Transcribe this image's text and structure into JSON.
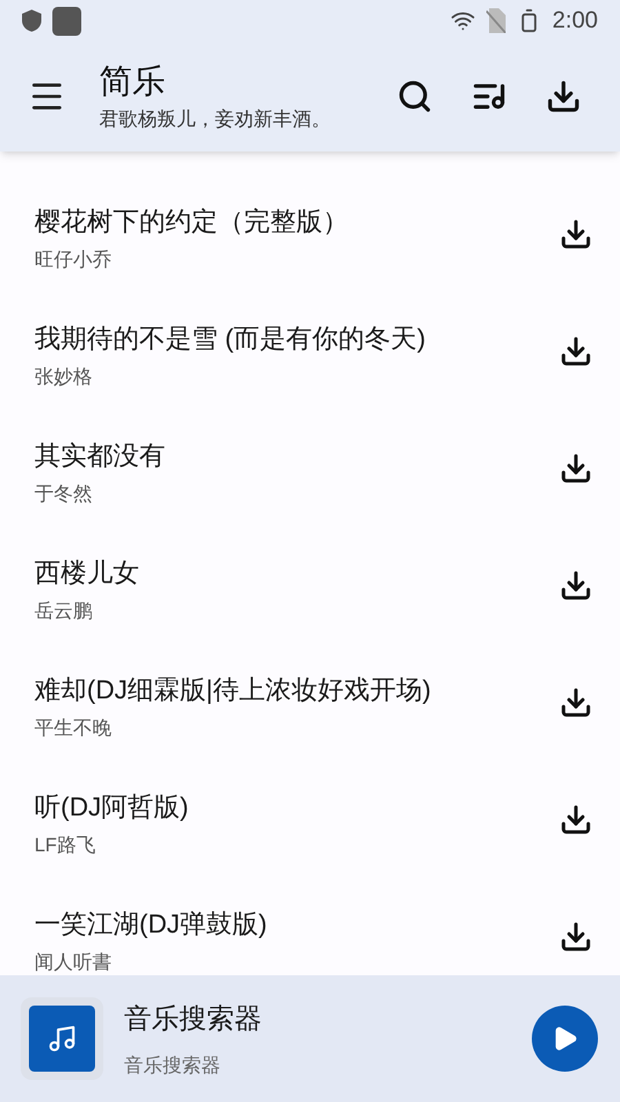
{
  "status_bar": {
    "time": "2:00"
  },
  "app_bar": {
    "title": "简乐",
    "subtitle": "君歌杨叛儿，妾劝新丰酒。"
  },
  "songs": [
    {
      "title": "樱花树下的约定（完整版）",
      "artist": "旺仔小乔"
    },
    {
      "title": "我期待的不是雪 (而是有你的冬天)",
      "artist": "张妙格"
    },
    {
      "title": "其实都没有",
      "artist": "于冬然"
    },
    {
      "title": "西楼儿女",
      "artist": "岳云鹏"
    },
    {
      "title": "难却(DJ细霖版|待上浓妆好戏开场)",
      "artist": "平生不晚"
    },
    {
      "title": "听(DJ阿哲版)",
      "artist": "LF路飞"
    },
    {
      "title": "一笑江湖(DJ弹鼓版)",
      "artist": "闻人听書"
    }
  ],
  "player": {
    "title": "音乐搜索器",
    "subtitle": "音乐搜索器"
  }
}
